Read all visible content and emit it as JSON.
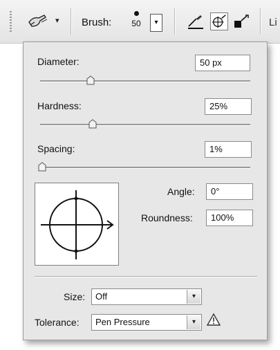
{
  "toolbar": {
    "tool_icon": "brush-tool-icon",
    "tool_menu_arrow": "▾",
    "brush_label": "Brush:",
    "brush_size": "50",
    "brush_dropdown_arrow": "▾",
    "mode_icons": [
      "pen-line-icon",
      "crosshair-brush-icon",
      "square-brush-icon"
    ],
    "cut_text": "Li"
  },
  "panel": {
    "diameter": {
      "label": "Diameter:",
      "value": "50 px",
      "slider_fraction": 0.24
    },
    "hardness": {
      "label": "Hardness:",
      "value": "25%",
      "slider_fraction": 0.25
    },
    "spacing": {
      "label": "Spacing:",
      "value": "1%",
      "slider_fraction": 0.01
    },
    "preview_icon": "brush-tip-preview-icon",
    "angle": {
      "label": "Angle:",
      "value": "0°"
    },
    "roundness": {
      "label": "Roundness:",
      "value": "100%"
    },
    "size": {
      "label": "Size:",
      "value": "Off",
      "dropdown_arrow": "▾"
    },
    "tolerance": {
      "label": "Tolerance:",
      "value": "Pen Pressure",
      "dropdown_arrow": "▾"
    },
    "warning_icon": "warning-triangle-icon"
  }
}
